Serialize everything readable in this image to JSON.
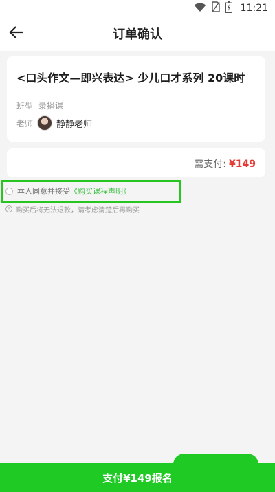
{
  "status_bar": {
    "time": "11:21"
  },
  "header": {
    "title": "订单确认"
  },
  "course": {
    "title": "<口头作文—即兴表达> 少儿口才系列 20课时",
    "type_label": "班型",
    "type_value": "录播课",
    "teacher_label": "老师",
    "teacher_name": "静静老师"
  },
  "payment": {
    "label": "需支付:",
    "amount": "¥149"
  },
  "agreement": {
    "text": "本人同意并接受",
    "link": "《购买课程声明》"
  },
  "notice": {
    "text": "购买后将无法退款，请考虑清楚后再购买"
  },
  "bottom": {
    "button_label": "支付¥149报名"
  },
  "colors": {
    "accent": "#1fca25",
    "price": "#e53935",
    "highlight": "#28c421"
  }
}
